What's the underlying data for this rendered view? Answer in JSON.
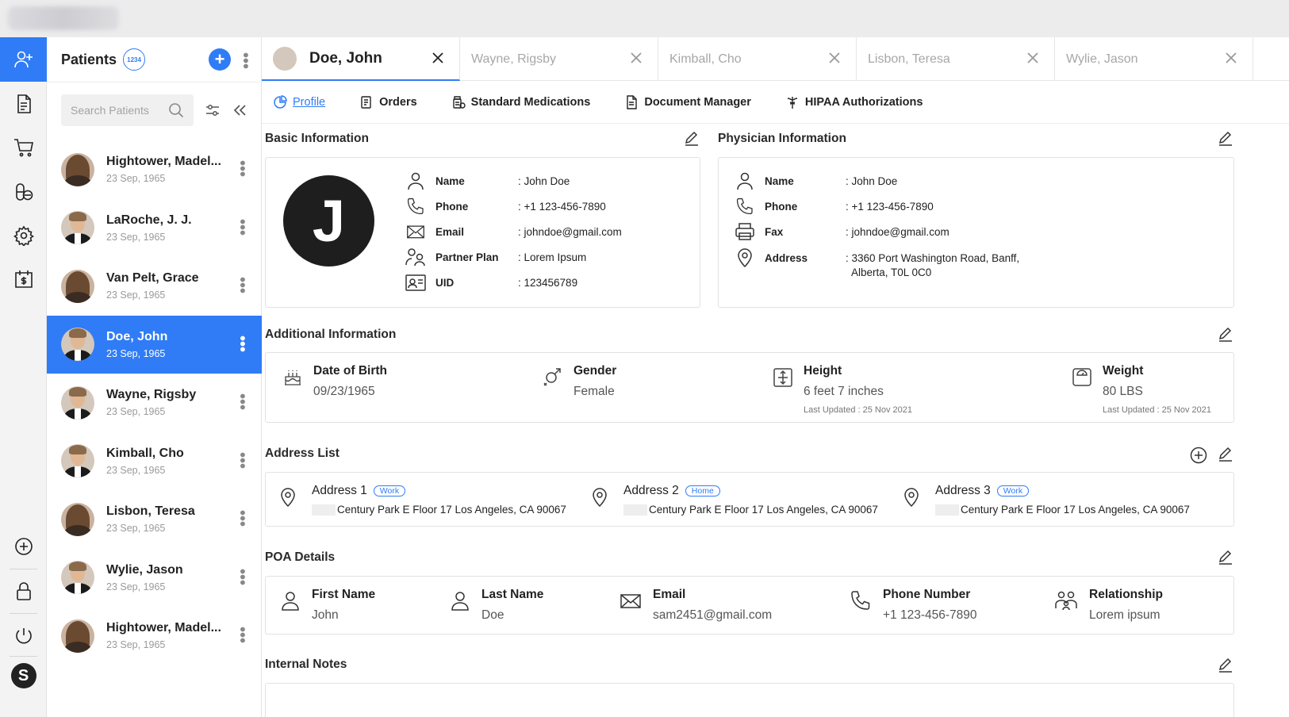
{
  "colors": {
    "accent": "#2f7cf6",
    "sidebar_bg": "#f3f3f4",
    "text": "#222222"
  },
  "rail": {
    "items": [
      {
        "icon": "add-user-icon",
        "active": true
      },
      {
        "icon": "document-icon"
      },
      {
        "icon": "cart-icon"
      },
      {
        "icon": "pills-icon"
      },
      {
        "icon": "gear-icon"
      },
      {
        "icon": "billing-icon"
      }
    ],
    "bottom": [
      {
        "icon": "plus-circle-icon"
      },
      {
        "icon": "lock-icon"
      },
      {
        "icon": "power-icon"
      }
    ],
    "avatar_letter": "S"
  },
  "patients": {
    "title": "Patients",
    "count_badge": "1234",
    "search_placeholder": "Search Patients",
    "items": [
      {
        "name": "Hightower, Madel...",
        "date": "23 Sep, 1965",
        "gender": "f"
      },
      {
        "name": "LaRoche, J. J.",
        "date": "23 Sep, 1965",
        "gender": "m"
      },
      {
        "name": "Van Pelt, Grace",
        "date": "23 Sep, 1965",
        "gender": "f"
      },
      {
        "name": "Doe, John",
        "date": "23 Sep, 1965",
        "gender": "m",
        "active": true
      },
      {
        "name": "Wayne, Rigsby",
        "date": "23 Sep, 1965",
        "gender": "m"
      },
      {
        "name": "Kimball, Cho",
        "date": "23 Sep, 1965",
        "gender": "m"
      },
      {
        "name": "Lisbon, Teresa",
        "date": "23 Sep, 1965",
        "gender": "f"
      },
      {
        "name": "Wylie, Jason",
        "date": "23 Sep, 1965",
        "gender": "m"
      },
      {
        "name": "Hightower, Madel...",
        "date": "23 Sep, 1965",
        "gender": "f"
      }
    ]
  },
  "tabs": [
    {
      "label": "Doe, John",
      "active": true
    },
    {
      "label": "Wayne, Rigsby"
    },
    {
      "label": "Kimball, Cho"
    },
    {
      "label": "Lisbon, Teresa"
    },
    {
      "label": "Wylie, Jason"
    }
  ],
  "subnav": [
    {
      "label": "Profile",
      "icon": "profile-icon",
      "active": true
    },
    {
      "label": "Orders",
      "icon": "orders-icon"
    },
    {
      "label": "Standard Medications",
      "icon": "medications-icon"
    },
    {
      "label": "Document Manager",
      "icon": "document-icon"
    },
    {
      "label": "HIPAA Authorizations",
      "icon": "caduceus-icon"
    }
  ],
  "basic": {
    "title": "Basic Information",
    "avatar_letter": "J",
    "fields": [
      {
        "label": "Name",
        "value": ": John Doe"
      },
      {
        "label": "Phone",
        "value": ": +1 123-456-7890"
      },
      {
        "label": "Email",
        "value": ": johndoe@gmail.com"
      },
      {
        "label": "Partner Plan",
        "value": ": Lorem Ipsum"
      },
      {
        "label": "UID",
        "value": ": 123456789"
      }
    ]
  },
  "physician": {
    "title": "Physician Information",
    "fields": [
      {
        "label": "Name",
        "value": ": John Doe"
      },
      {
        "label": "Phone",
        "value": ": +1 123-456-7890"
      },
      {
        "label": "Fax",
        "value": ": johndoe@gmail.com"
      },
      {
        "label": "Address",
        "value": ": 3360 Port Washington Road, Banff,",
        "value2": "Alberta, T0L 0C0"
      }
    ]
  },
  "additional": {
    "title": "Additional Information",
    "items": [
      {
        "label": "Date of Birth",
        "value": "09/23/1965"
      },
      {
        "label": "Gender",
        "value": "Female"
      },
      {
        "label": "Height",
        "value": "6 feet 7 inches",
        "updated": "Last Updated : 25 Nov 2021"
      },
      {
        "label": "Weight",
        "value": "80 LBS",
        "updated": "Last Updated : 25 Nov 2021"
      }
    ]
  },
  "addresses": {
    "title": "Address List",
    "items": [
      {
        "label": "Address 1",
        "tag": "Work",
        "line": "Century Park E Floor 17 Los Angeles, CA 90067"
      },
      {
        "label": "Address 2",
        "tag": "Home",
        "line": "Century Park E Floor 17 Los Angeles, CA 90067"
      },
      {
        "label": "Address 3",
        "tag": "Work",
        "line": "Century Park E Floor 17 Los Angeles, CA 90067"
      }
    ]
  },
  "poa": {
    "title": "POA Details",
    "items": [
      {
        "label": "First Name",
        "value": "John"
      },
      {
        "label": "Last Name",
        "value": "Doe"
      },
      {
        "label": "Email",
        "value": "sam2451@gmail.com"
      },
      {
        "label": "Phone Number",
        "value": "+1 123-456-7890"
      },
      {
        "label": "Relationship",
        "value": "Lorem ipsum"
      }
    ]
  },
  "notes": {
    "title": "Internal Notes"
  }
}
